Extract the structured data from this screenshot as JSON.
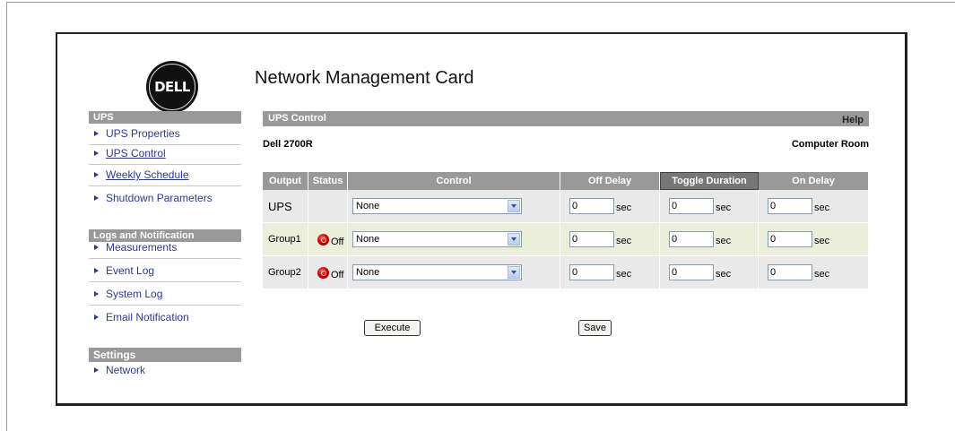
{
  "app": {
    "logo_text": "DELL",
    "title": "Network Management Card"
  },
  "sidebar": {
    "sections": [
      {
        "header": "UPS",
        "items": [
          {
            "label": "UPS Properties"
          },
          {
            "label": "UPS Control"
          },
          {
            "label": "Weekly Schedule"
          },
          {
            "label": "Shutdown Parameters"
          }
        ]
      },
      {
        "header": "Logs and Notification",
        "items": [
          {
            "label": "Measurements"
          },
          {
            "label": "Event Log"
          },
          {
            "label": "System Log"
          },
          {
            "label": "Email Notification"
          }
        ]
      },
      {
        "header": "Settings",
        "items": [
          {
            "label": "Network"
          }
        ]
      }
    ]
  },
  "main": {
    "header_title": "UPS Control",
    "help_label": "Help",
    "model": "Dell 2700R",
    "location": "Computer Room",
    "columns": [
      "Output",
      "Status",
      "Control",
      "Off Delay",
      "Toggle Duration",
      "On Delay"
    ],
    "rows": [
      {
        "output": "UPS",
        "status": "",
        "control": "None",
        "off_delay": "0",
        "toggle_duration": "0",
        "on_delay": "0"
      },
      {
        "output": "Group1",
        "status": "Off",
        "control": "None",
        "off_delay": "0",
        "toggle_duration": "0",
        "on_delay": "0"
      },
      {
        "output": "Group2",
        "status": "Off",
        "control": "None",
        "off_delay": "0",
        "toggle_duration": "0",
        "on_delay": "0"
      }
    ],
    "unit": "sec",
    "execute_label": "Execute",
    "save_label": "Save"
  },
  "colors": {
    "header_gray": "#999999",
    "link_blue": "#2a3b8f",
    "row_gray": "#e9e9e9",
    "row_olive": "#ebeedb",
    "led_red": "#cc0000"
  },
  "icons": {
    "status": "red-led-icon",
    "nav_bullet": "triangle-right-icon",
    "select_arrow": "chevron-down-icon"
  }
}
